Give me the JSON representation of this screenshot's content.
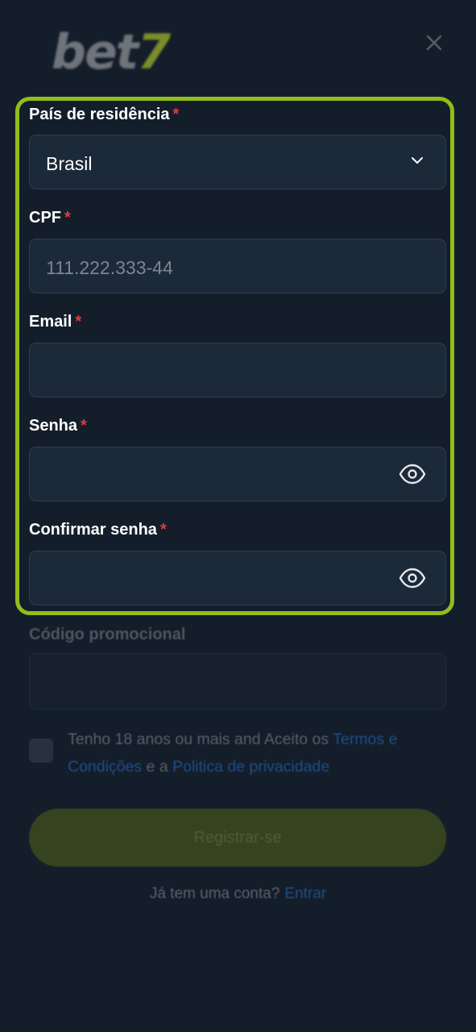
{
  "header": {
    "logo_text": "bet",
    "logo_accent": "7",
    "close_icon": "close-icon"
  },
  "form": {
    "country": {
      "label": "País de residência",
      "required": "*",
      "value": "Brasil"
    },
    "cpf": {
      "label": "CPF",
      "required": "*",
      "placeholder": "111.222.333-44"
    },
    "email": {
      "label": "Email",
      "required": "*",
      "value": ""
    },
    "password": {
      "label": "Senha",
      "required": "*",
      "value": ""
    },
    "confirm_password": {
      "label": "Confirmar senha",
      "required": "*",
      "value": ""
    },
    "promo": {
      "label": "Código promocional",
      "value": ""
    },
    "terms": {
      "text_before": "Tenho 18 anos ou mais and Aceito os ",
      "terms_link": "Termos e Condições",
      "text_middle": " e a ",
      "privacy_link": "Politica de privacidade"
    },
    "register_button": "Registrar-se",
    "login_prompt": "Já tem uma conta?",
    "login_link": "Entrar"
  },
  "colors": {
    "background": "#141e2b",
    "highlight_border": "#92bd1c",
    "required_star": "#e03c3c",
    "link": "#1f4d87"
  }
}
